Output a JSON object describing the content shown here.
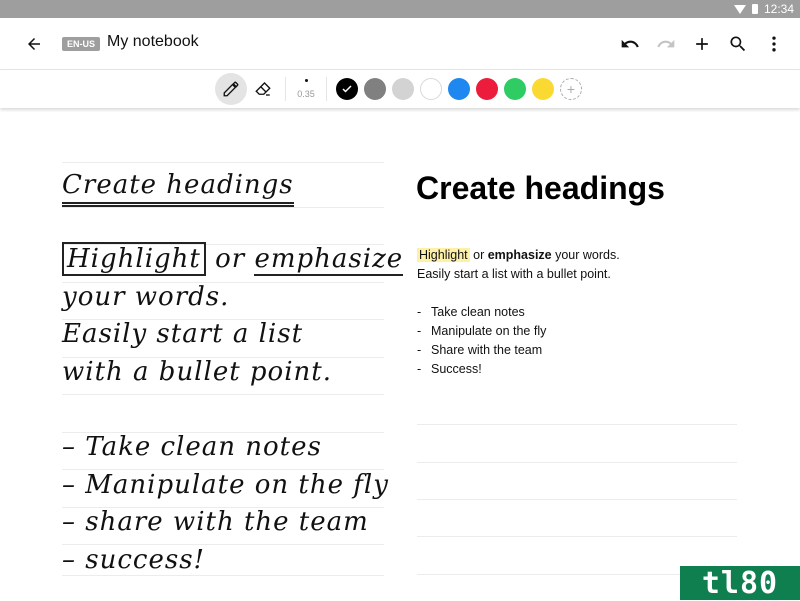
{
  "status_bar": {
    "time": "12:34",
    "icons": [
      "wifi-icon",
      "battery-icon"
    ]
  },
  "app_bar": {
    "back_icon": "arrow-left-icon",
    "language_badge": "EN-US",
    "title": "My notebook",
    "actions": [
      {
        "name": "undo",
        "icon": "undo-icon",
        "enabled": true
      },
      {
        "name": "redo",
        "icon": "redo-icon",
        "enabled": false
      },
      {
        "name": "add",
        "icon": "plus-icon",
        "enabled": true
      },
      {
        "name": "search",
        "icon": "search-icon",
        "enabled": true
      },
      {
        "name": "more",
        "icon": "more-vert-icon",
        "enabled": true
      }
    ]
  },
  "toolbar": {
    "tools": [
      {
        "name": "pen",
        "icon": "pencil-icon",
        "active": true
      },
      {
        "name": "eraser",
        "icon": "eraser-icon",
        "active": false
      }
    ],
    "stroke_size": "0.35",
    "colors": [
      {
        "name": "black",
        "hex": "#000000",
        "selected": true
      },
      {
        "name": "dark-gray",
        "hex": "#808080",
        "selected": false
      },
      {
        "name": "light-gray",
        "hex": "#d3d3d3",
        "selected": false
      },
      {
        "name": "white",
        "hex": "#ffffff",
        "selected": false
      },
      {
        "name": "blue",
        "hex": "#1e88f0",
        "selected": false
      },
      {
        "name": "red",
        "hex": "#ec1c3c",
        "selected": false
      },
      {
        "name": "green",
        "hex": "#2ecc62",
        "selected": false
      },
      {
        "name": "yellow",
        "hex": "#fbd933",
        "selected": false
      }
    ],
    "add_color_label": "+"
  },
  "handwriting": {
    "heading": "Create headings",
    "line1_boxed": "Highlight",
    "line1_mid": " or ",
    "line1_underlined": "emphasize",
    "line2": "your words.",
    "line3": "Easily start a list",
    "line4": "with a bullet point.",
    "bullets": [
      "Take clean notes",
      "Manipulate on the fly",
      "share with the team",
      "success!"
    ],
    "bullet_mark": "–"
  },
  "typed": {
    "heading": "Create headings",
    "highlight": "Highlight",
    "or": " or ",
    "emphasize": "emphasize",
    "rest1": " your words.",
    "line2": "Easily start a list with a bullet point.",
    "bullet_mark": "-",
    "bullets": [
      "Take clean notes",
      "Manipulate on the fly",
      "Share with the team",
      "Success!"
    ],
    "highlight_color": "#fdf1a8"
  },
  "watermark": "tl80"
}
